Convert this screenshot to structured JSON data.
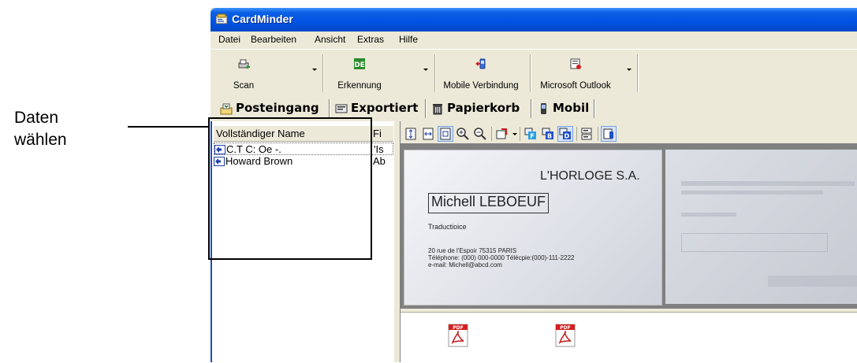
{
  "annotation": {
    "label_line1": "Daten",
    "label_line2": "wählen"
  },
  "window": {
    "title": "CardMinder"
  },
  "menu": [
    "Datei",
    "Bearbeiten",
    "Ansicht",
    "Extras",
    "Hilfe"
  ],
  "toolbar": {
    "scan": "Scan",
    "recognition": "Erkennung",
    "mobile": "Mobile Verbindung",
    "outlook": "Microsoft Outlook"
  },
  "tabs": [
    "Posteingang",
    "Exportiert",
    "Papierkorb",
    "Mobil"
  ],
  "list": {
    "columns": [
      "Vollständiger Name",
      "Fi"
    ],
    "rows": [
      {
        "name": "C.T C: Oe -.",
        "first": "'Is"
      },
      {
        "name": "Howard Brown",
        "first": "Ab"
      }
    ]
  },
  "card": {
    "company": "L'HORLOGE S.A.",
    "name": "Michell LEBOEUF",
    "title": "Traductioice",
    "address": "20 rue de l'Espoir 75315 PARIS",
    "phone": "Téléphone: (000) 000-0000   Télécpie:(000)-111-2222",
    "email": "e-mail: Michell@abcd.com"
  },
  "colors": {
    "titlebar": "#0054e3",
    "chrome": "#ece9d8"
  },
  "thumbnails": [
    "pdf-icon",
    "pdf-icon"
  ]
}
